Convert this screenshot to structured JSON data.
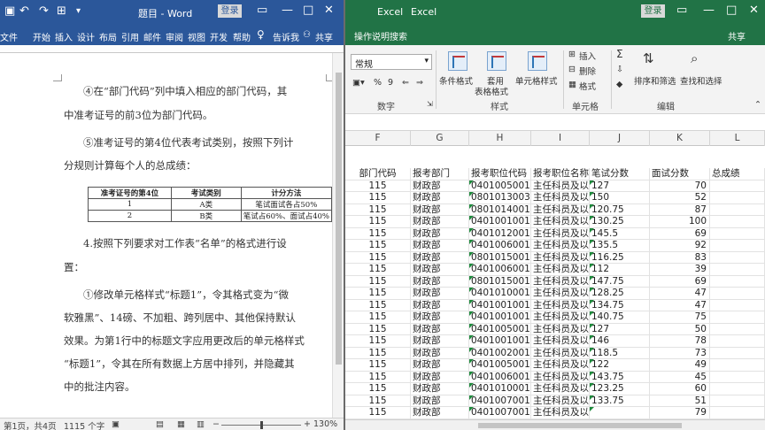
{
  "word": {
    "title": "题目 - Word",
    "login": "登录",
    "tabs": [
      "文件",
      "开始",
      "插入",
      "设计",
      "布局",
      "引用",
      "邮件",
      "审阅",
      "视图",
      "开发",
      "帮助"
    ],
    "tell_me": "告诉我",
    "share": "共享",
    "page": {
      "lines": [
        "④在“部门代码”列中填入相应的部门代码，其",
        "中准考证号的前3位为部门代码。",
        "⑤准考证号的第4位代表考试类别，按照下列计",
        "分规则计算每个人的总成绩：",
        "4.按照下列要求对工作表“名单”的格式进行设",
        "置：",
        "①修改单元格样式“标题1”，令其格式变为“微",
        "软雅黑”、14磅、不加粗、跨列居中、其他保持默认",
        "效果。为第1行中的标题文字应用更改后的单元格样式",
        "“标题1”，令其在所有数据上方居中排列，并隐藏其",
        "中的批注内容。"
      ],
      "table": {
        "headers": [
          "准考证号的第4位",
          "考试类别",
          "计分方法"
        ],
        "rows": [
          [
            "1",
            "A类",
            "笔试面试各占50%"
          ],
          [
            "2",
            "B类",
            "笔试占60%、面试占40%"
          ]
        ]
      }
    },
    "status": {
      "page": "第1页，共4页",
      "words": "1115 个字",
      "zoom": "130%",
      "zoom_minus": "−",
      "zoom_plus": "+"
    }
  },
  "excel": {
    "title_left": "Excel",
    "title_right": "Excel",
    "login": "登录",
    "tell_me": "操作说明搜索",
    "share": "共享",
    "ribbon": {
      "number_format": "常规",
      "number_group": "数字",
      "conditional": "条件格式",
      "table_format_1": "套用",
      "table_format_2": "表格格式",
      "cell_style": "单元格样式",
      "styles_group": "样式",
      "insert": "插入",
      "delete": "删除",
      "format": "格式",
      "cells_group": "单元格",
      "sort_filter": "排序和筛选",
      "find_select": "查找和选择",
      "edit_group": "编辑",
      "percent": "%",
      "comma": "9"
    },
    "columns": [
      "F",
      "G",
      "H",
      "I",
      "J",
      "K",
      "L"
    ],
    "header_row": [
      "部门代码",
      "报考部门",
      "报考职位代码",
      "报考职位名称",
      "笔试分数",
      "面试分数",
      "总成绩"
    ],
    "rows": [
      [
        "115",
        "财政部",
        "0401005001",
        "主任科员及以",
        "127",
        "70",
        ""
      ],
      [
        "115",
        "财政部",
        "0801013003",
        "主任科员及以",
        "150",
        "52",
        ""
      ],
      [
        "115",
        "财政部",
        "0801014001",
        "主任科员及以",
        "120.75",
        "87",
        ""
      ],
      [
        "115",
        "财政部",
        "0401001001",
        "主任科员及以",
        "130.25",
        "100",
        ""
      ],
      [
        "115",
        "财政部",
        "0401012001",
        "主任科员及以",
        "145.5",
        "69",
        ""
      ],
      [
        "115",
        "财政部",
        "0401006001",
        "主任科员及以",
        "135.5",
        "92",
        ""
      ],
      [
        "115",
        "财政部",
        "0801015001",
        "主任科员及以",
        "116.25",
        "83",
        ""
      ],
      [
        "115",
        "财政部",
        "0401006001",
        "主任科员及以",
        "112",
        "39",
        ""
      ],
      [
        "115",
        "财政部",
        "0801015001",
        "主任科员及以",
        "147.75",
        "69",
        ""
      ],
      [
        "115",
        "财政部",
        "0401010001",
        "主任科员及以",
        "128.25",
        "47",
        ""
      ],
      [
        "115",
        "财政部",
        "0401001001",
        "主任科员及以",
        "134.75",
        "47",
        ""
      ],
      [
        "115",
        "财政部",
        "0401001001",
        "主任科员及以",
        "140.75",
        "75",
        ""
      ],
      [
        "115",
        "财政部",
        "0401005001",
        "主任科员及以",
        "127",
        "50",
        ""
      ],
      [
        "115",
        "财政部",
        "0401001001",
        "主任科员及以",
        "146",
        "78",
        ""
      ],
      [
        "115",
        "财政部",
        "0401002001",
        "主任科员及以",
        "118.5",
        "73",
        ""
      ],
      [
        "115",
        "财政部",
        "0401005001",
        "主任科员及以",
        "122",
        "49",
        ""
      ],
      [
        "115",
        "财政部",
        "0401006001",
        "主任科员及以",
        "143.75",
        "45",
        ""
      ],
      [
        "115",
        "财政部",
        "0401010001",
        "主任科员及以",
        "123.25",
        "60",
        ""
      ],
      [
        "115",
        "财政部",
        "0401007001",
        "主任科员及以",
        "133.75",
        "51",
        ""
      ],
      [
        "115",
        "财政部",
        "0401007001",
        "主任科员及以",
        "",
        "79",
        ""
      ]
    ]
  },
  "colors": {
    "word_blue": "#2b579a",
    "excel_green": "#217346"
  }
}
